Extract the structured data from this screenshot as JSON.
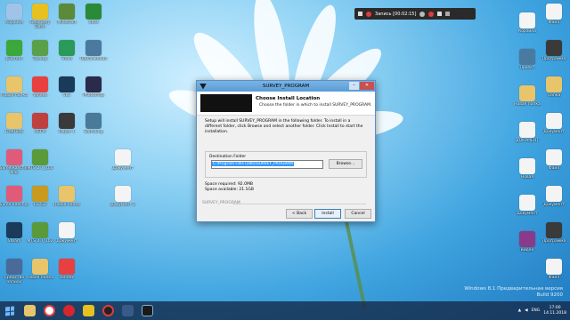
{
  "desktop": {
    "col1": [
      {
        "label": "Корзина",
        "icon": "recycle-bin-icon",
        "color": "#9fc4e8"
      },
      {
        "label": "µTorrent",
        "icon": "utorrent-icon",
        "color": "#3aa83a"
      },
      {
        "label": "Новая папка",
        "icon": "folder-icon",
        "color": "#e8c46a"
      },
      {
        "label": "FreeFileS",
        "icon": "folder-icon",
        "color": "#e8c46a"
      },
      {
        "label": "Slime Rancher Mac",
        "icon": "game-icon",
        "color": "#e05a7a"
      },
      {
        "label": "Slime Rancher",
        "icon": "game-icon",
        "color": "#e05a7a"
      },
      {
        "label": "Steam",
        "icon": "steam-icon",
        "color": "#1b3b5a"
      },
      {
        "label": "Средство записи",
        "icon": "app-icon",
        "color": "#4a6a9a"
      }
    ],
    "col2": [
      {
        "label": "Geometry Dash",
        "icon": "game-icon",
        "color": "#e8c020"
      },
      {
        "label": "Трекер",
        "icon": "app-icon",
        "color": "#5aa04a"
      },
      {
        "label": "Yandex",
        "icon": "yandex-icon",
        "color": "#e84040"
      },
      {
        "label": "ЛЕГО",
        "icon": "game-icon",
        "color": "#c04040"
      },
      {
        "label": "MTS 2.7_100",
        "icon": "game-icon",
        "color": "#5a9a3a"
      },
      {
        "label": "CS GO",
        "icon": "game-icon",
        "color": "#c89a20"
      },
      {
        "label": "MTS 2.7_102",
        "icon": "game-icon",
        "color": "#5a9a3a"
      },
      {
        "label": "Новая папка",
        "icon": "folder-icon",
        "color": "#e8c46a"
      }
    ],
    "col3": [
      {
        "label": "Minecraft",
        "icon": "minecraft-icon",
        "color": "#5a8a3a"
      },
      {
        "label": "Trovo",
        "icon": "app-icon",
        "color": "#2a9a5a"
      },
      {
        "label": "VLC",
        "icon": "app-icon",
        "color": "#1a3a5a"
      },
      {
        "label": "Player 1",
        "icon": "game-icon",
        "color": "#3a3a3a"
      },
      {
        "label": "",
        "icon": "",
        "color": ""
      },
      {
        "label": "Новая папка",
        "icon": "folder-icon",
        "color": "#e8c46a"
      },
      {
        "label": "Документ",
        "icon": "document-icon",
        "color": "#f4f4f4"
      },
      {
        "label": "Yandex",
        "icon": "yandex-icon",
        "color": "#e84040"
      }
    ],
    "col4": [
      {
        "label": "Xbox",
        "icon": "app-icon",
        "color": "#2a8a3a"
      },
      {
        "label": "Приложение",
        "icon": "app-icon",
        "color": "#4a7aa0"
      },
      {
        "label": "Photoshop",
        "icon": "app-icon",
        "color": "#2a2a4a"
      },
      {
        "label": "Samsung",
        "icon": "app-icon",
        "color": "#4a7a9a"
      }
    ],
    "col5": [
      {
        "label": "",
        "icon": "",
        "color": ""
      },
      {
        "label": "",
        "icon": "",
        "color": ""
      },
      {
        "label": "",
        "icon": "",
        "color": ""
      },
      {
        "label": "",
        "icon": "",
        "color": ""
      },
      {
        "label": "Документ",
        "icon": "document-icon",
        "color": "#f4f4f4"
      },
      {
        "label": "Документ 2",
        "icon": "document-icon",
        "color": "#f4f4f4"
      }
    ],
    "colR1": [
      {
        "label": "Корзина",
        "icon": "app-icon",
        "color": "#f4f4f4"
      },
      {
        "label": "Проект",
        "icon": "app-icon",
        "color": "#4a7aa0"
      },
      {
        "label": "Новая папка",
        "icon": "folder-icon",
        "color": "#e8c46a"
      },
      {
        "label": "ДОКУМЕНТ",
        "icon": "document-icon",
        "color": "#f4f4f4"
      },
      {
        "label": "Новая",
        "icon": "document-icon",
        "color": "#f4f4f4"
      },
      {
        "label": "Документ",
        "icon": "document-icon",
        "color": "#f4f4f4"
      },
      {
        "label": "Видео",
        "icon": "app-icon",
        "color": "#8a3a8a"
      }
    ],
    "colR2": [
      {
        "label": "Файл",
        "icon": "document-icon",
        "color": "#f4f4f4"
      },
      {
        "label": "Программа",
        "icon": "app-icon",
        "color": "#3a3a3a"
      },
      {
        "label": "Папка",
        "icon": "folder-icon",
        "color": "#e8c46a"
      },
      {
        "label": "Документ",
        "icon": "document-icon",
        "color": "#f4f4f4"
      },
      {
        "label": "Файл",
        "icon": "document-icon",
        "color": "#f4f4f4"
      },
      {
        "label": "Документ",
        "icon": "document-icon",
        "color": "#f4f4f4"
      },
      {
        "label": "Программа",
        "icon": "app-icon",
        "color": "#3a3a3a"
      },
      {
        "label": "Файл",
        "icon": "document-icon",
        "color": "#f4f4f4"
      }
    ]
  },
  "recorder": {
    "label": "Запись [00:02:15]"
  },
  "installer": {
    "title": "SURVEY_PROGRAM",
    "heading": "Choose Install Location",
    "subheading": "Choose the folder in which to install SURVEY_PROGRAM.",
    "description": "Setup will install SURVEY_PROGRAM in the following folder. To install in a different folder, click Browse and select another folder. Click Install to start the installation.",
    "group_label": "Destination Folder",
    "path_value": "C:\\Program Files (x86)\\SURVEY_PROGRAM",
    "browse_label": "Browse...",
    "space_required": "Space required: 92.0MB",
    "space_available": "Space available: 21.1GB",
    "brand": "SURVEY_PROGRAM",
    "back_label": "< Back",
    "install_label": "Install",
    "cancel_label": "Cancel"
  },
  "watermark": {
    "line1": "Windows 8.1 Предварительная версия",
    "line2": "Build 9200"
  },
  "taskbar": {
    "lang": "ENG",
    "time": "17:00",
    "date": "14.11.2018"
  }
}
